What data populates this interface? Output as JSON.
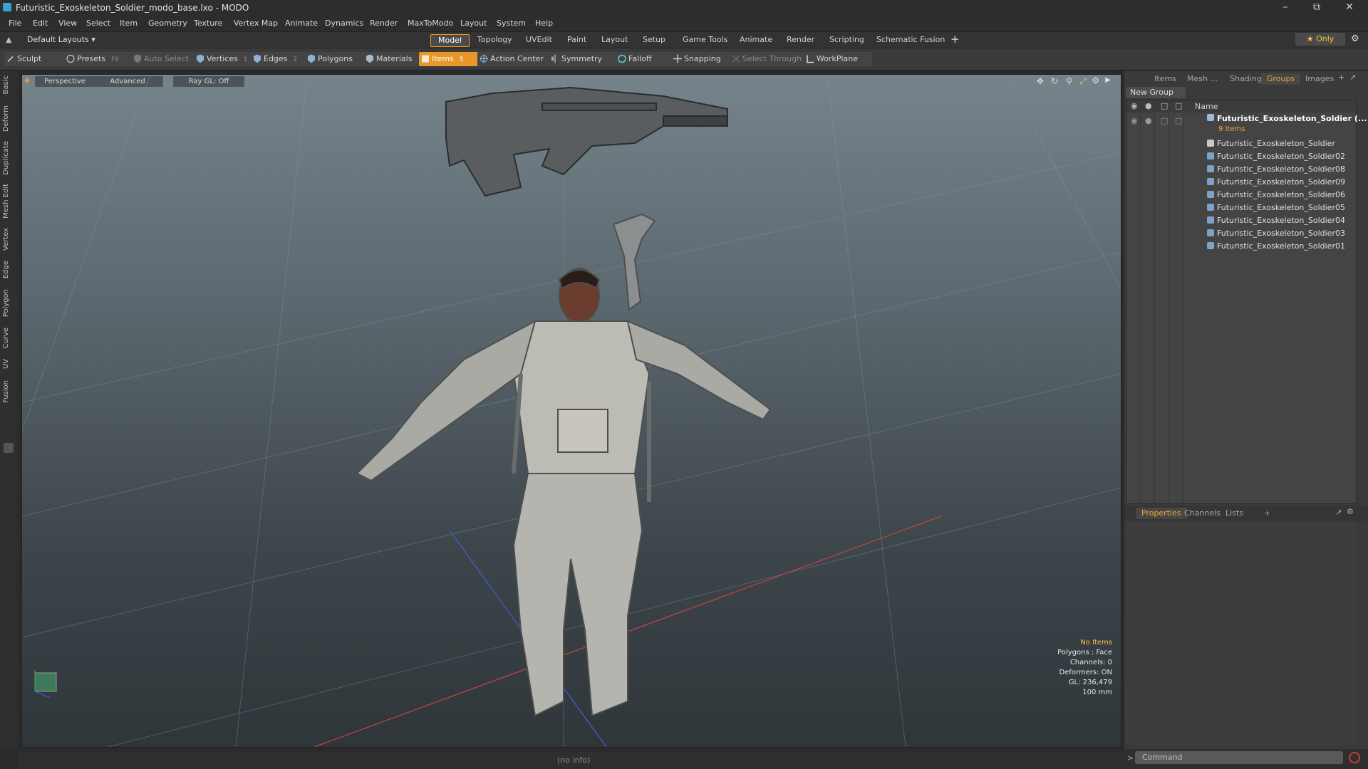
{
  "window": {
    "title": "Futuristic_Exoskeleton_Soldier_modo_base.lxo - MODO",
    "controls": [
      "–",
      "⧉",
      "✕"
    ]
  },
  "menu": [
    "File",
    "Edit",
    "View",
    "Select",
    "Item",
    "Geometry",
    "Texture",
    "Vertex Map",
    "Animate",
    "Dynamics",
    "Render",
    "MaxToModo",
    "Layout",
    "System",
    "Help"
  ],
  "layout": {
    "selector": "Default Layouts ▾",
    "tabs": [
      "Model",
      "Topology",
      "UVEdit",
      "Paint",
      "Layout",
      "Setup",
      "Game Tools",
      "Animate",
      "Render",
      "Scripting",
      "Schematic Fusion"
    ],
    "active_tab": "Model",
    "add": "+",
    "only": "★ Only"
  },
  "toolbar": {
    "sculpt": "Sculpt",
    "presets": "Presets",
    "presets_key": "F6",
    "auto_select": "Auto Select",
    "vertices": "Vertices",
    "vertices_key": "1",
    "edges": "Edges",
    "edges_key": "2",
    "polygons": "Polygons",
    "materials": "Materials",
    "items": "Items",
    "items_key": "5",
    "action_center": "Action Center",
    "symmetry": "Symmetry",
    "falloff": "Falloff",
    "snapping": "Snapping",
    "select_through": "Select Through",
    "workplane": "WorkPlane"
  },
  "left_tabs": [
    "Basic",
    "Deform",
    "Duplicate",
    "Mesh Edit",
    "Vertex",
    "Edge",
    "Polygon",
    "Curve",
    "UV",
    "Fusion"
  ],
  "viewport": {
    "view": "Perspective",
    "shading": "Advanced",
    "raygl": "Ray GL: Off",
    "hud": {
      "selection": "No Items",
      "polygons": "Polygons : Face",
      "channels": "Channels: 0",
      "deformers": "Deformers: ON",
      "gl": "GL: 236,479",
      "scale": "100 mm"
    }
  },
  "right_panel": {
    "tabs": [
      "Items",
      "Mesh ...",
      "Shading",
      "Groups",
      "Images"
    ],
    "active_tab": "Groups",
    "new_group": "New Group",
    "column_name": "Name",
    "group": {
      "name": "Futuristic_Exoskeleton_Soldier",
      "suffix": "(...",
      "count": "9 Items",
      "items": [
        "Futuristic_Exoskeleton_Soldier",
        "Futuristic_Exoskeleton_Soldier02",
        "Futuristic_Exoskeleton_Soldier08",
        "Futuristic_Exoskeleton_Soldier09",
        "Futuristic_Exoskeleton_Soldier06",
        "Futuristic_Exoskeleton_Soldier05",
        "Futuristic_Exoskeleton_Soldier04",
        "Futuristic_Exoskeleton_Soldier03",
        "Futuristic_Exoskeleton_Soldier01"
      ]
    },
    "bottom_tabs": [
      "Properties",
      "Channels",
      "Lists"
    ],
    "bottom_active": "Properties"
  },
  "status": {
    "info": "(no info)",
    "command_placeholder": "Command"
  },
  "colors": {
    "accent": "#f39c12",
    "items_active": "#e8962a",
    "hud_highlight": "#f5c542"
  }
}
